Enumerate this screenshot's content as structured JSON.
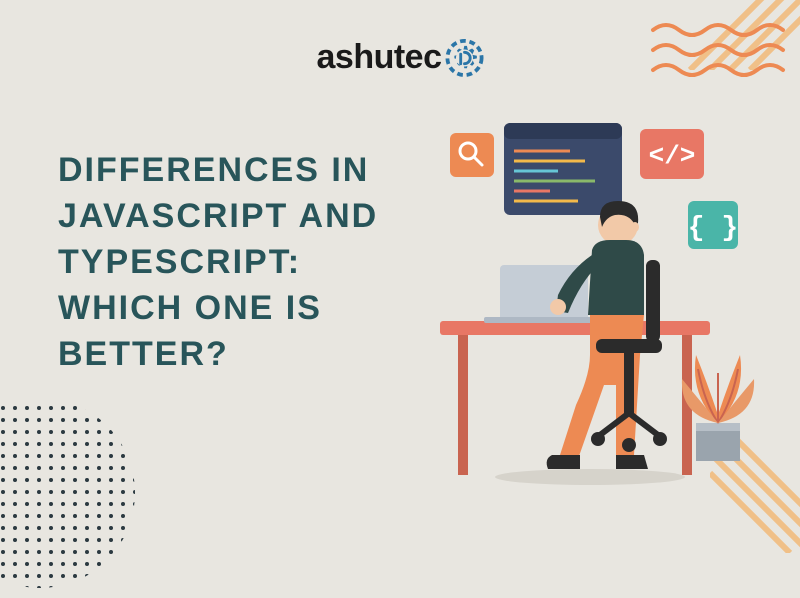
{
  "brand": {
    "name": "ashutec"
  },
  "title": "DIFFERENCES IN JAVASCRIPT AND TYPESCRIPT: WHICH ONE IS BETTER?",
  "colors": {
    "bg": "#e8e6e0",
    "title": "#28555a",
    "accent_orange": "#ed8a53",
    "accent_teal": "#4ab5a8",
    "accent_coral": "#e87765",
    "accent_navy": "#3b4a6b",
    "gear": "#2b76a8"
  }
}
